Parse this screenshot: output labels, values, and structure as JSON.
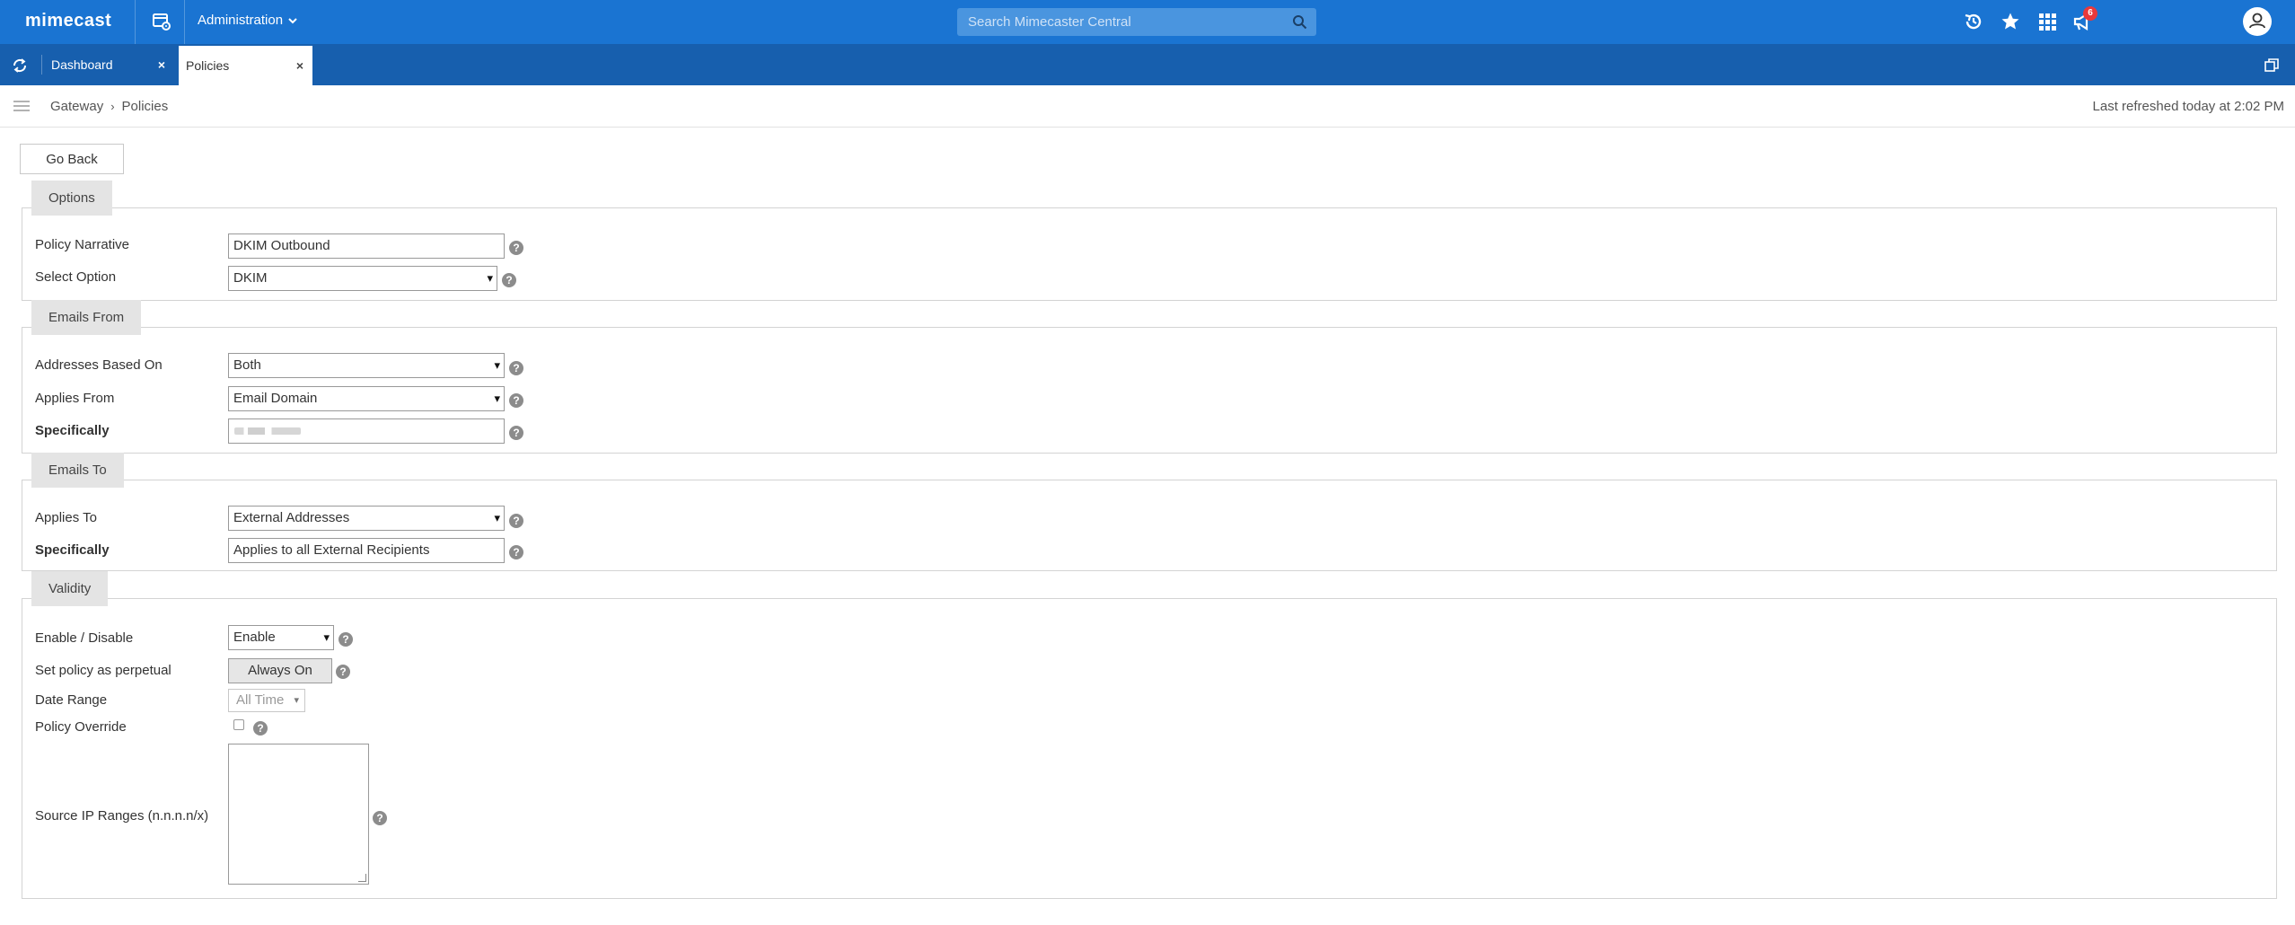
{
  "app": {
    "logo": "mimecast",
    "admin_menu_label": "Administration",
    "search_placeholder": "Search Mimecaster Central",
    "notification_count": "6"
  },
  "tabs": [
    {
      "label": "Dashboard",
      "close": "×"
    },
    {
      "label": "Policies",
      "close": "×"
    }
  ],
  "breadcrumb": {
    "items": [
      "Gateway",
      "Policies"
    ],
    "separator": "›"
  },
  "last_refreshed": "Last refreshed today at 2:02 PM",
  "go_back_label": "Go Back",
  "help_glyph": "?",
  "sections": {
    "options": {
      "legend": "Options",
      "policy_narrative_label": "Policy Narrative",
      "policy_narrative_value": "DKIM Outbound",
      "select_option_label": "Select Option",
      "select_option_value": "DKIM"
    },
    "emails_from": {
      "legend": "Emails From",
      "addresses_based_on_label": "Addresses Based On",
      "addresses_based_on_value": "Both",
      "applies_from_label": "Applies From",
      "applies_from_value": "Email Domain",
      "specifically_label": "Specifically"
    },
    "emails_to": {
      "legend": "Emails To",
      "applies_to_label": "Applies To",
      "applies_to_value": "External Addresses",
      "specifically_label": "Specifically",
      "specifically_value": "Applies to all External Recipients"
    },
    "validity": {
      "legend": "Validity",
      "enable_label": "Enable / Disable",
      "enable_value": "Enable",
      "perpetual_label": "Set policy as perpetual",
      "perpetual_button": "Always On",
      "date_range_label": "Date Range",
      "date_range_value": "All Time",
      "override_label": "Policy Override",
      "override_checked": false,
      "source_ip_label": "Source IP Ranges (n.n.n.n/x)"
    }
  },
  "colors": {
    "topbar": "#1a74d2",
    "tabbar": "#175fae",
    "search_bg": "#4a95df",
    "badge": "#e8383b",
    "legend_bg": "#e4e4e4"
  }
}
